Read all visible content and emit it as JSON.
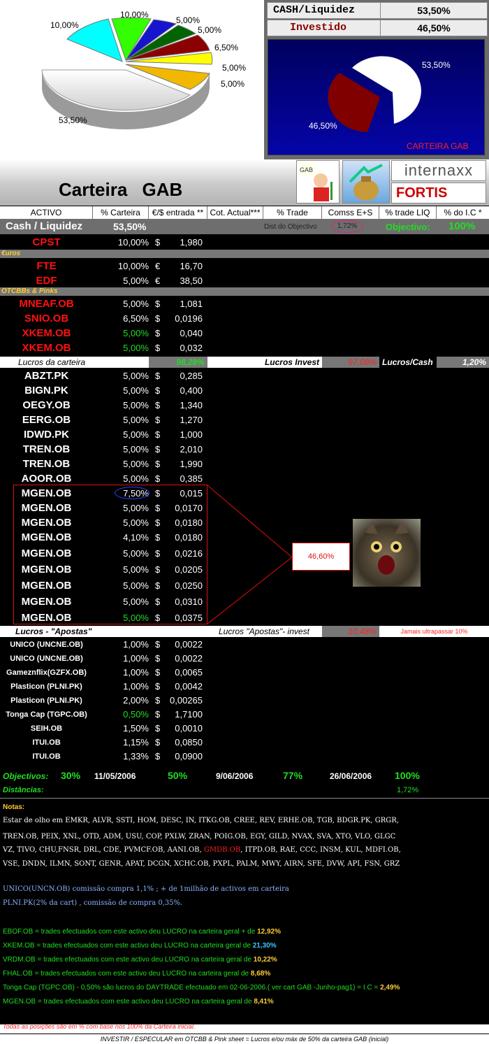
{
  "pie_main": {
    "labels": [
      "10,00%",
      "10,00%",
      "5,00%",
      "5,00%",
      "6,50%",
      "5,00%",
      "5,00%",
      "53,50%"
    ]
  },
  "summary": {
    "cash_label": "CASH/Liquidez",
    "cash_value": "53,50%",
    "inv_label": "Investido",
    "inv_value": "46,50%",
    "pie_cash": "53,50%",
    "pie_inv": "46,50%",
    "pie_caption": "CARTEIRA GAB"
  },
  "banner": {
    "title": "Carteira GAB",
    "logo1": "internaxx",
    "logo2": "FORTIS",
    "gab": "GAB"
  },
  "headers": [
    "ACTIVO",
    "% Carteira",
    "€/$ entrada **",
    "Cot. Actual***",
    "% Trade",
    "Comss E+S",
    "% trade LIQ",
    "% do I.C *"
  ],
  "cash": {
    "label": "Cash / Liquidez",
    "value": "53,50%",
    "dist_label": "Dist do Objectivo",
    "dist_value": "1,72%",
    "obj_label": "Objectivo:",
    "obj_value": "100%"
  },
  "sections": {
    "euros": "€uros",
    "otc": "OTCBBs & Pinks"
  },
  "rows_a": [
    {
      "n": "CPST",
      "p": "10,00%",
      "c": "$",
      "v": "1,980"
    }
  ],
  "rows_b": [
    {
      "n": "FTE",
      "p": "10,00%",
      "c": "€",
      "v": "16,70"
    },
    {
      "n": "EDF",
      "p": "5,00%",
      "c": "€",
      "v": "38,50"
    }
  ],
  "rows_c": [
    {
      "n": "MNEAF.OB",
      "p": "5,00%",
      "c": "$",
      "v": "1,081"
    },
    {
      "n": "SNIO.OB",
      "p": "6,50%",
      "c": "$",
      "v": "0,0196"
    },
    {
      "n": "XKEM.OB",
      "p": "5,00%",
      "c": "$",
      "v": "0,040"
    },
    {
      "n": "XKEM.OB",
      "p": "5,00%",
      "c": "$",
      "v": "0,032"
    }
  ],
  "lucros_band": {
    "l1": "Lucros da carteira",
    "v1": "98,28%",
    "l2": "Lucros Invest",
    "v2": "97,08%",
    "l3": "Lucros/Cash",
    "v3": "1,20%"
  },
  "rows_d": [
    {
      "n": "ABZT.PK",
      "p": "5,00%",
      "c": "$",
      "v": "0,285"
    },
    {
      "n": "BIGN.PK",
      "p": "5,00%",
      "c": "$",
      "v": "0,400"
    },
    {
      "n": "OEGY.OB",
      "p": "5,00%",
      "c": "$",
      "v": "1,340"
    },
    {
      "n": "EERG.OB",
      "p": "5,00%",
      "c": "$",
      "v": "1,270"
    },
    {
      "n": "IDWD.PK",
      "p": "5,00%",
      "c": "$",
      "v": "1,000"
    },
    {
      "n": "TREN.OB",
      "p": "5,00%",
      "c": "$",
      "v": "2,010"
    },
    {
      "n": "TREN.OB",
      "p": "5,00%",
      "c": "$",
      "v": "1,990"
    },
    {
      "n": "AOOR.OB",
      "p": "5,00%",
      "c": "$",
      "v": "0,385"
    },
    {
      "n": "MGEN.OB",
      "p": "7,50%",
      "c": "$",
      "v": "0,015"
    },
    {
      "n": "MGEN.OB",
      "p": "5,00%",
      "c": "$",
      "v": "0,0170"
    },
    {
      "n": "MGEN.OB",
      "p": "5,00%",
      "c": "$",
      "v": "0,0180"
    },
    {
      "n": "MGEN.OB",
      "p": "4,10%",
      "c": "$",
      "v": "0,0180"
    },
    {
      "n": "MGEN.OB",
      "p": "5,00%",
      "c": "$",
      "v": "0,0216"
    },
    {
      "n": "MGEN.OB",
      "p": "5,00%",
      "c": "$",
      "v": "0,0205"
    },
    {
      "n": "MGEN.OB",
      "p": "5,00%",
      "c": "$",
      "v": "0,0250"
    },
    {
      "n": "MGEN.OB",
      "p": "5,00%",
      "c": "$",
      "v": "0,0310"
    },
    {
      "n": "MGEN.OB",
      "p": "5,00%",
      "c": "$",
      "v": "0,0375"
    }
  ],
  "callout": "46,60%",
  "apostas_band": {
    "l1": "Lucros - \"Apostas\"",
    "l2": "Lucros \"Apostas\"- invest",
    "v2": "10,48%",
    "l3": "Jamais ultrapassar 10%"
  },
  "rows_e": [
    {
      "n": "UNICO (UNCNE.OB)",
      "p": "1,00%",
      "c": "$",
      "v": "0,0022"
    },
    {
      "n": "UNICO (UNCNE.OB)",
      "p": "1,00%",
      "c": "$",
      "v": "0,0022"
    },
    {
      "n": "Gameznflix(GZFX.OB)",
      "p": "1,00%",
      "c": "$",
      "v": "0,0065"
    },
    {
      "n": "Plasticon (PLNI.PK)",
      "p": "1,00%",
      "c": "$",
      "v": "0,0042"
    },
    {
      "n": "Plasticon (PLNI.PK)",
      "p": "2,00%",
      "c": "$",
      "v": "0,00265"
    },
    {
      "n": "Tonga Cap (TGPC.OB)",
      "p": "0,50%",
      "c": "$",
      "v": "1,7100"
    },
    {
      "n": "SEIH.OB",
      "p": "1,50%",
      "c": "$",
      "v": "0,0010"
    },
    {
      "n": "ITUI.OB",
      "p": "1,15%",
      "c": "$",
      "v": "0,0850"
    },
    {
      "n": "ITUI.OB",
      "p": "1,33%",
      "c": "$",
      "v": "0,0900"
    }
  ],
  "objectivos": {
    "label": "Objectivos:",
    "o1": "30%",
    "d1": "11/05/2006",
    "o2": "50%",
    "d2": "9/06/2006",
    "o3": "77%",
    "d3": "26/06/2006",
    "o4": "100%",
    "dist_label": "Distâncias:",
    "dist": "1,72%"
  },
  "notes": {
    "title": "Notas:",
    "l1a": "Estar de olho em  EMKR, ALVR, SSTI, HOM, DESC, IN, ITKG.OB, CREE, REV, ERHE.OB, TGB, BDGR.PK, GRGR,",
    "l2": "TREN.OB, PEIX, XNL, OTD, ADM, USU, COP, PXLW, ZRAN, POIG.OB, EGY, GILD, NVAX, SVA, XTO, VLO, GLGC",
    "l3a": "VZ, TIVO, CHU,FNSR, DRL, CDE, PVMCF.OB, AANI.OB, ",
    "l3b": "GMDB.OB",
    "l3c": ", ITPD.OB, RAE, CCC, INSM, KUL, MDFI.OB,",
    "l4": "VSE, DNDN, ILMN, SONT, GENR, APAT, DCGN, XCHC.OB, PXPL, PALM, MWY, AIRN, SFE, DVW, API, FSN, GRZ",
    "u1": "UNICO(UNCN.OB) comissão compra 1,1% ; + de 1milhão de activos em carteira",
    "u2": "PLNI.PK(2% da cart) , comissão de compra 0,35%.",
    "g1": "EBOF.OB = trades efectuados com este activo  deu LUCRO na carteira geral + de ",
    "g1v": "12,92%",
    "g2": "XKEM.OB = trades efectuados com este activo  deu LUCRO na carteira geral de ",
    "g2v": "21,30%",
    "g3": "VRDM.OB = trades efectuados com este activo  deu LUCRO na carteira geral de ",
    "g3v": "10,22%",
    "g4": "FHAL.OB = trades efectuados com este activo  deu LUCRO na carteira geral de ",
    "g4v": "8,68%",
    "g5": "Tonga Cap (TGPC.OB) -  0,50% são lucros  do DAYTRADE efectuado em 02-06-2006.( ver cart GAB -Junho-pag1) = I.C = ",
    "g5v": "2,49%",
    "g6": "MGEN.OB = trades efectuados com este activo  deu LUCRO na carteira geral de ",
    "g6v": "8,41%",
    "foot1": "Todas as posições são em % com base nos 100% da Carteira inicial.",
    "foot2": "INVESTIR / ESPECULAR em OTCBB & Pink sheet  =  Lucros e/ou máx de 50% da carteira GAB (inicial)"
  }
}
